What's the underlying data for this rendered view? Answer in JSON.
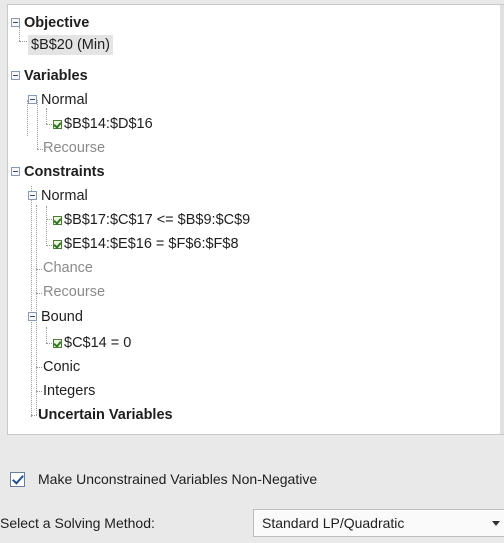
{
  "tree": {
    "objective": {
      "label": "Objective",
      "cell": "$B$20 (Min)"
    },
    "variables": {
      "label": "Variables",
      "normal": {
        "label": "Normal",
        "item": "$B$14:$D$16"
      },
      "recourse": "Recourse"
    },
    "constraints": {
      "label": "Constraints",
      "normal": {
        "label": "Normal",
        "items": [
          "$B$17:$C$17 <= $B$9:$C$9",
          "$E$14:$E$16 = $F$6:$F$8"
        ]
      },
      "chance": "Chance",
      "recourse": "Recourse",
      "bound": {
        "label": "Bound",
        "item": "$C$14 = 0"
      },
      "conic": "Conic",
      "integers": "Integers"
    },
    "uncertain_variables": "Uncertain Variables"
  },
  "options": {
    "nonneg_label": "Make Unconstrained Variables Non-Negative",
    "nonneg_checked": true
  },
  "solving_method": {
    "label": "Select a Solving Method:",
    "value": "Standard LP/Quadratic"
  }
}
